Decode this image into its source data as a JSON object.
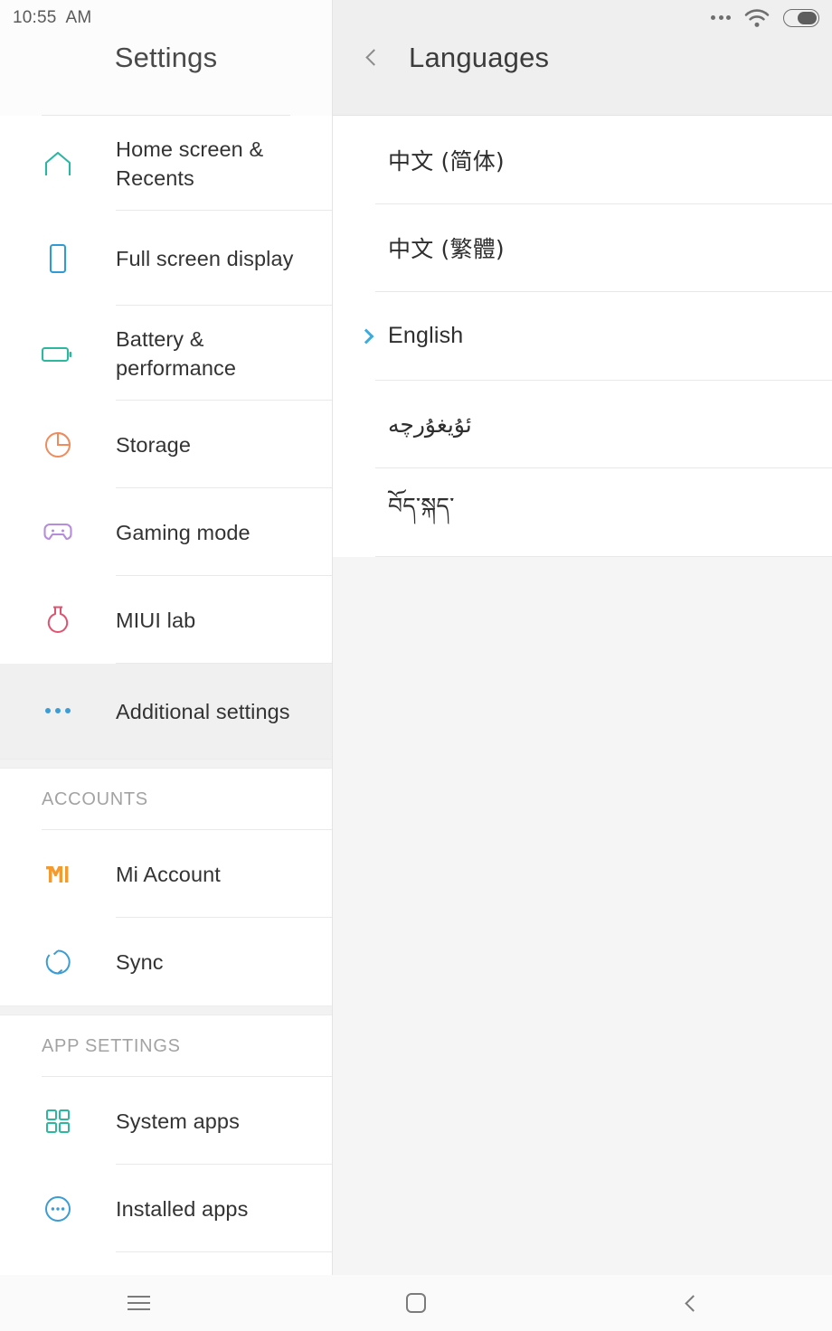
{
  "statusbar": {
    "time": "10:55  AM",
    "icons": [
      "more-dots-icon",
      "wifi-icon",
      "battery-icon"
    ],
    "battery_level_pct": 62
  },
  "sidebar": {
    "title": "Settings",
    "items": [
      {
        "label": "Home screen & Recents",
        "icon": "home-icon",
        "color": "#2bb6a3",
        "selected": false
      },
      {
        "label": "Full screen display",
        "icon": "phone-icon",
        "color": "#2f9ad6",
        "selected": false
      },
      {
        "label": "Battery & performance",
        "icon": "battery-outline-icon",
        "color": "#2bb89e",
        "selected": false
      },
      {
        "label": "Storage",
        "icon": "pie-chart-icon",
        "color": "#ef8c5e",
        "selected": false
      },
      {
        "label": "Gaming mode",
        "icon": "gamepad-icon",
        "color": "#b58ddb",
        "selected": false
      },
      {
        "label": "MIUI lab",
        "icon": "flask-icon",
        "color": "#e0526f",
        "selected": false
      },
      {
        "label": "Additional settings",
        "icon": "more-dots-icon",
        "color": "#3c9cd4",
        "selected": true
      }
    ],
    "groups": [
      {
        "header": "ACCOUNTS",
        "items": [
          {
            "label": "Mi Account",
            "icon": "mi-logo-icon",
            "color": "#f59a2e"
          },
          {
            "label": "Sync",
            "icon": "sync-icon",
            "color": "#3c9cd4"
          }
        ]
      },
      {
        "header": "APP SETTINGS",
        "items": [
          {
            "label": "System apps",
            "icon": "app-grid-icon",
            "color": "#2bb89e"
          },
          {
            "label": "Installed apps",
            "icon": "dots-circle-icon",
            "color": "#3c9cd4"
          }
        ]
      }
    ]
  },
  "panel": {
    "back_icon": "chevron-left-icon",
    "title": "Languages",
    "languages": [
      {
        "name": "中文 (简体)",
        "script": "cjk",
        "selected": false
      },
      {
        "name": "中文 (繁體)",
        "script": "cjk",
        "selected": false
      },
      {
        "name": "English",
        "script": "latin",
        "selected": true
      },
      {
        "name": "ئۇيغۇرچە",
        "script": "rtl",
        "selected": false
      },
      {
        "name": "བོད་སྐད་",
        "script": "tibetan",
        "selected": false
      }
    ],
    "selected_marker_color": "#3cabe0"
  },
  "navbar": {
    "buttons": [
      {
        "name": "menu-button",
        "icon": "hamburger-icon"
      },
      {
        "name": "home-button",
        "icon": "square-icon"
      },
      {
        "name": "back-button",
        "icon": "chevron-left-icon"
      }
    ]
  }
}
